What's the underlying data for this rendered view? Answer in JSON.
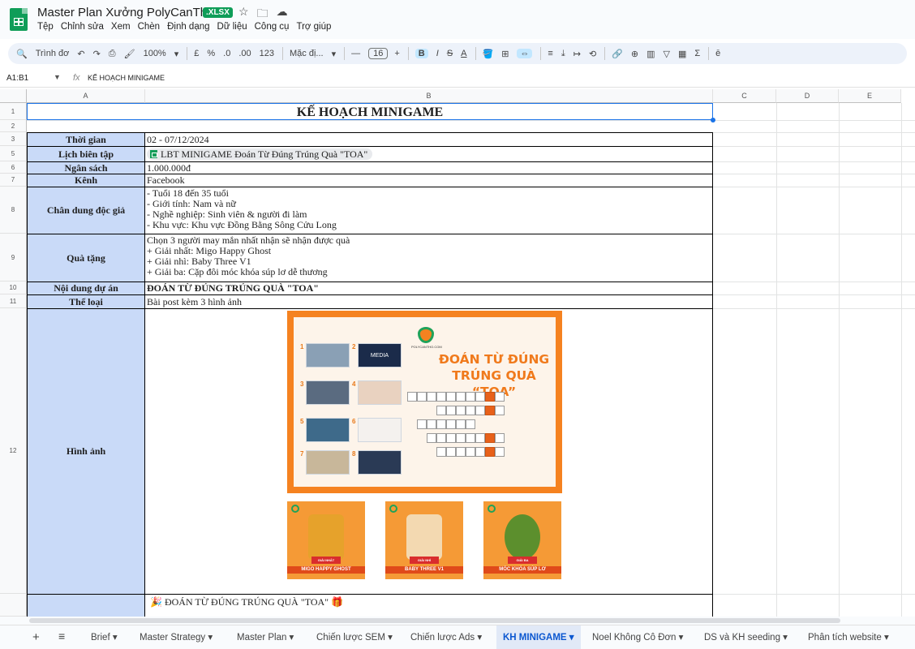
{
  "doc": {
    "title": "Master Plan Xưởng PolyCanTho",
    "badge": ".XLSX",
    "icons": [
      "star-icon",
      "folder-icon",
      "cloud-icon"
    ]
  },
  "menu": [
    "Tệp",
    "Chỉnh sửa",
    "Xem",
    "Chèn",
    "Định dạng",
    "Dữ liệu",
    "Công cụ",
    "Trợ giúp"
  ],
  "toolbar": {
    "search": "Trình đơ",
    "zoom": "100%",
    "currency": "£",
    "percent": "%",
    "dec_decrease": ".0",
    "dec_increase": ".00",
    "format_123": "123",
    "font": "Mặc đị...",
    "minus": "—",
    "font_size": "16",
    "plus": "+",
    "bold": "B",
    "italic": "I",
    "strike": "S",
    "text_color": "A",
    "sum": "Σ"
  },
  "formula_bar": {
    "name_box": "A1:B1",
    "fx": "fx",
    "content": "KẾ HOẠCH MINIGAME"
  },
  "columns": [
    "A",
    "B",
    "C",
    "D",
    "E"
  ],
  "rows": [
    "1",
    "2",
    "3",
    "5",
    "6",
    "7",
    "8",
    "9",
    "10",
    "11",
    "12",
    ""
  ],
  "sheet": {
    "title": "KẾ HOẠCH MINIGAME",
    "thoi_gian_label": "Thời gian",
    "thoi_gian_value": "02 - 07/12/2024",
    "lich_label": "Lịch biên tập",
    "lich_chip": "LBT MINIGAME Đoán Từ Đúng Trúng Quà \"TOA\"",
    "ngan_sach_label": "Ngân sách",
    "ngan_sach_value": "1.000.000đ",
    "kenh_label": "Kênh",
    "kenh_value": "Facebook",
    "chan_dung_label": "Chân dung độc giả",
    "chan_dung_lines": [
      "- Tuổi 18 đến 35 tuổi",
      "- Giới tính: Nam và nữ",
      "- Nghề nghiệp: Sinh viên & người đi làm",
      "- Khu vực: Khu vực Đồng Bằng Sông Cửu Long"
    ],
    "qua_tang_label": "Quà tặng",
    "qua_tang_lines": [
      "Chọn 3 người may mắn nhất nhận sẽ nhận được quà",
      "+ Giải nhất: Migo Happy Ghost",
      "+ Giải nhì: Baby Three V1",
      "+ Giải ba: Cặp đôi móc khóa súp lơ dễ thương"
    ],
    "noi_dung_label": "Nội dung dự án",
    "noi_dung_value": "ĐOÁN TỪ ĐÚNG TRÚNG QUÀ \"TOA\"",
    "the_loai_label": "Thể loại",
    "the_loai_value": "Bài post kèm 3 hình ảnh",
    "hinh_anh_label": "Hình ảnh",
    "last_row_text": "ĐOÁN TỪ ĐÚNG TRÚNG QUÀ \"TOA\""
  },
  "poster": {
    "headline_1": "ĐOÁN TỪ ĐÚNG",
    "headline_2": "TRÚNG QUÀ “TOA”",
    "brand": "POLYCANTHO.COM",
    "numbers": [
      "1",
      "2",
      "3",
      "4",
      "5",
      "6",
      "7",
      "8"
    ],
    "thumb_media": "MEDIA"
  },
  "prizes": [
    {
      "tag": "GIẢI NHẤT",
      "name": "MIGO HAPPY GHOST",
      "color": "#e6a22b"
    },
    {
      "tag": "GIẢI NHÌ",
      "name": "BABY THREE V1",
      "color": "#f3d9b1"
    },
    {
      "tag": "GIẢI BA",
      "name": "MÓC KHÓA SÚP LƠ",
      "color": "#5c8f2d"
    }
  ],
  "sheet_tabs": [
    "Brief",
    "Master Strategy",
    "Master Plan",
    "Chiến lược SEM",
    "Chiến lược Ads",
    "KH MINIGAME",
    "Noel Không Cô Đơn",
    "DS và KH seeding",
    "Phân tích website"
  ],
  "active_tab": "KH MINIGAME",
  "colors": {
    "label_bg": "#c9daf8",
    "accent": "#0f9d58",
    "selection": "#1a73e8"
  }
}
